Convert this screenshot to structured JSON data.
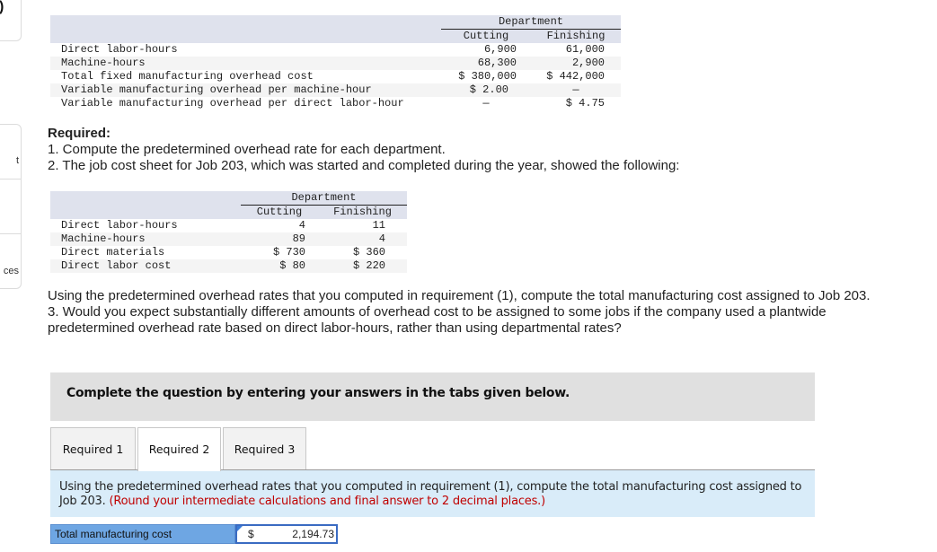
{
  "side": {
    "top_glyph": ")",
    "nav_items": [
      "t",
      "",
      "ces"
    ]
  },
  "table1": {
    "group_header": "Department",
    "columns": [
      "Cutting",
      "Finishing"
    ],
    "rows": [
      {
        "label": "Direct labor-hours",
        "cutting": "6,900",
        "finishing": "61,000"
      },
      {
        "label": "Machine-hours",
        "cutting": "68,300",
        "finishing": "2,900"
      },
      {
        "label": "Total fixed manufacturing overhead cost",
        "cutting": "$ 380,000",
        "finishing": "$ 442,000"
      },
      {
        "label": "Variable manufacturing overhead per machine-hour",
        "cutting": "$ 2.00",
        "finishing": "—"
      },
      {
        "label": "Variable manufacturing overhead per direct labor-hour",
        "cutting": "—",
        "finishing": "$ 4.75"
      }
    ]
  },
  "required": {
    "heading": "Required:",
    "item1": "1. Compute the predetermined overhead rate for each department.",
    "item2": "2. The job cost sheet for Job 203, which was started and completed during the year, showed the following:"
  },
  "table2": {
    "group_header": "Department",
    "columns": [
      "Cutting",
      "Finishing"
    ],
    "rows": [
      {
        "label": "Direct labor-hours",
        "cutting": "4",
        "finishing": "11"
      },
      {
        "label": "Machine-hours",
        "cutting": "89",
        "finishing": "4"
      },
      {
        "label": "Direct materials",
        "cutting": "$ 730",
        "finishing": "$ 360"
      },
      {
        "label": "Direct labor cost",
        "cutting": "$ 80",
        "finishing": "$ 220"
      }
    ]
  },
  "part2": {
    "text_a": "Using the predetermined overhead rates that you computed in requirement (1), compute the total manufacturing cost assigned to Job 203.",
    "text_b": "3. Would you expect substantially different amounts of overhead cost to be assigned to some jobs if the company used a plantwide predetermined overhead rate based on direct labor-hours, rather than using departmental rates?"
  },
  "instruction": "Complete the question by entering your answers in the tabs given below.",
  "tabs": [
    {
      "label": "Required 1",
      "active": false
    },
    {
      "label": "Required 2",
      "active": true
    },
    {
      "label": "Required 3",
      "active": false
    }
  ],
  "answer_panel": {
    "text": "Using the predetermined overhead rates that you computed in requirement (1), compute the total manufacturing cost assigned to Job 203. ",
    "note": "(Round your intermediate calculations and final answer to 2 decimal places.)"
  },
  "answer": {
    "label": "Total manufacturing cost",
    "currency": "$",
    "value": "2,194.73"
  },
  "colors": {
    "table_header": "#dfe2ed",
    "instruction_bg": "#e0e0e0",
    "answer_panel_bg": "#d9ecf9",
    "answer_label_bg": "#6ea6e3",
    "note_red": "#c00000",
    "input_border": "#3a6bc2"
  }
}
